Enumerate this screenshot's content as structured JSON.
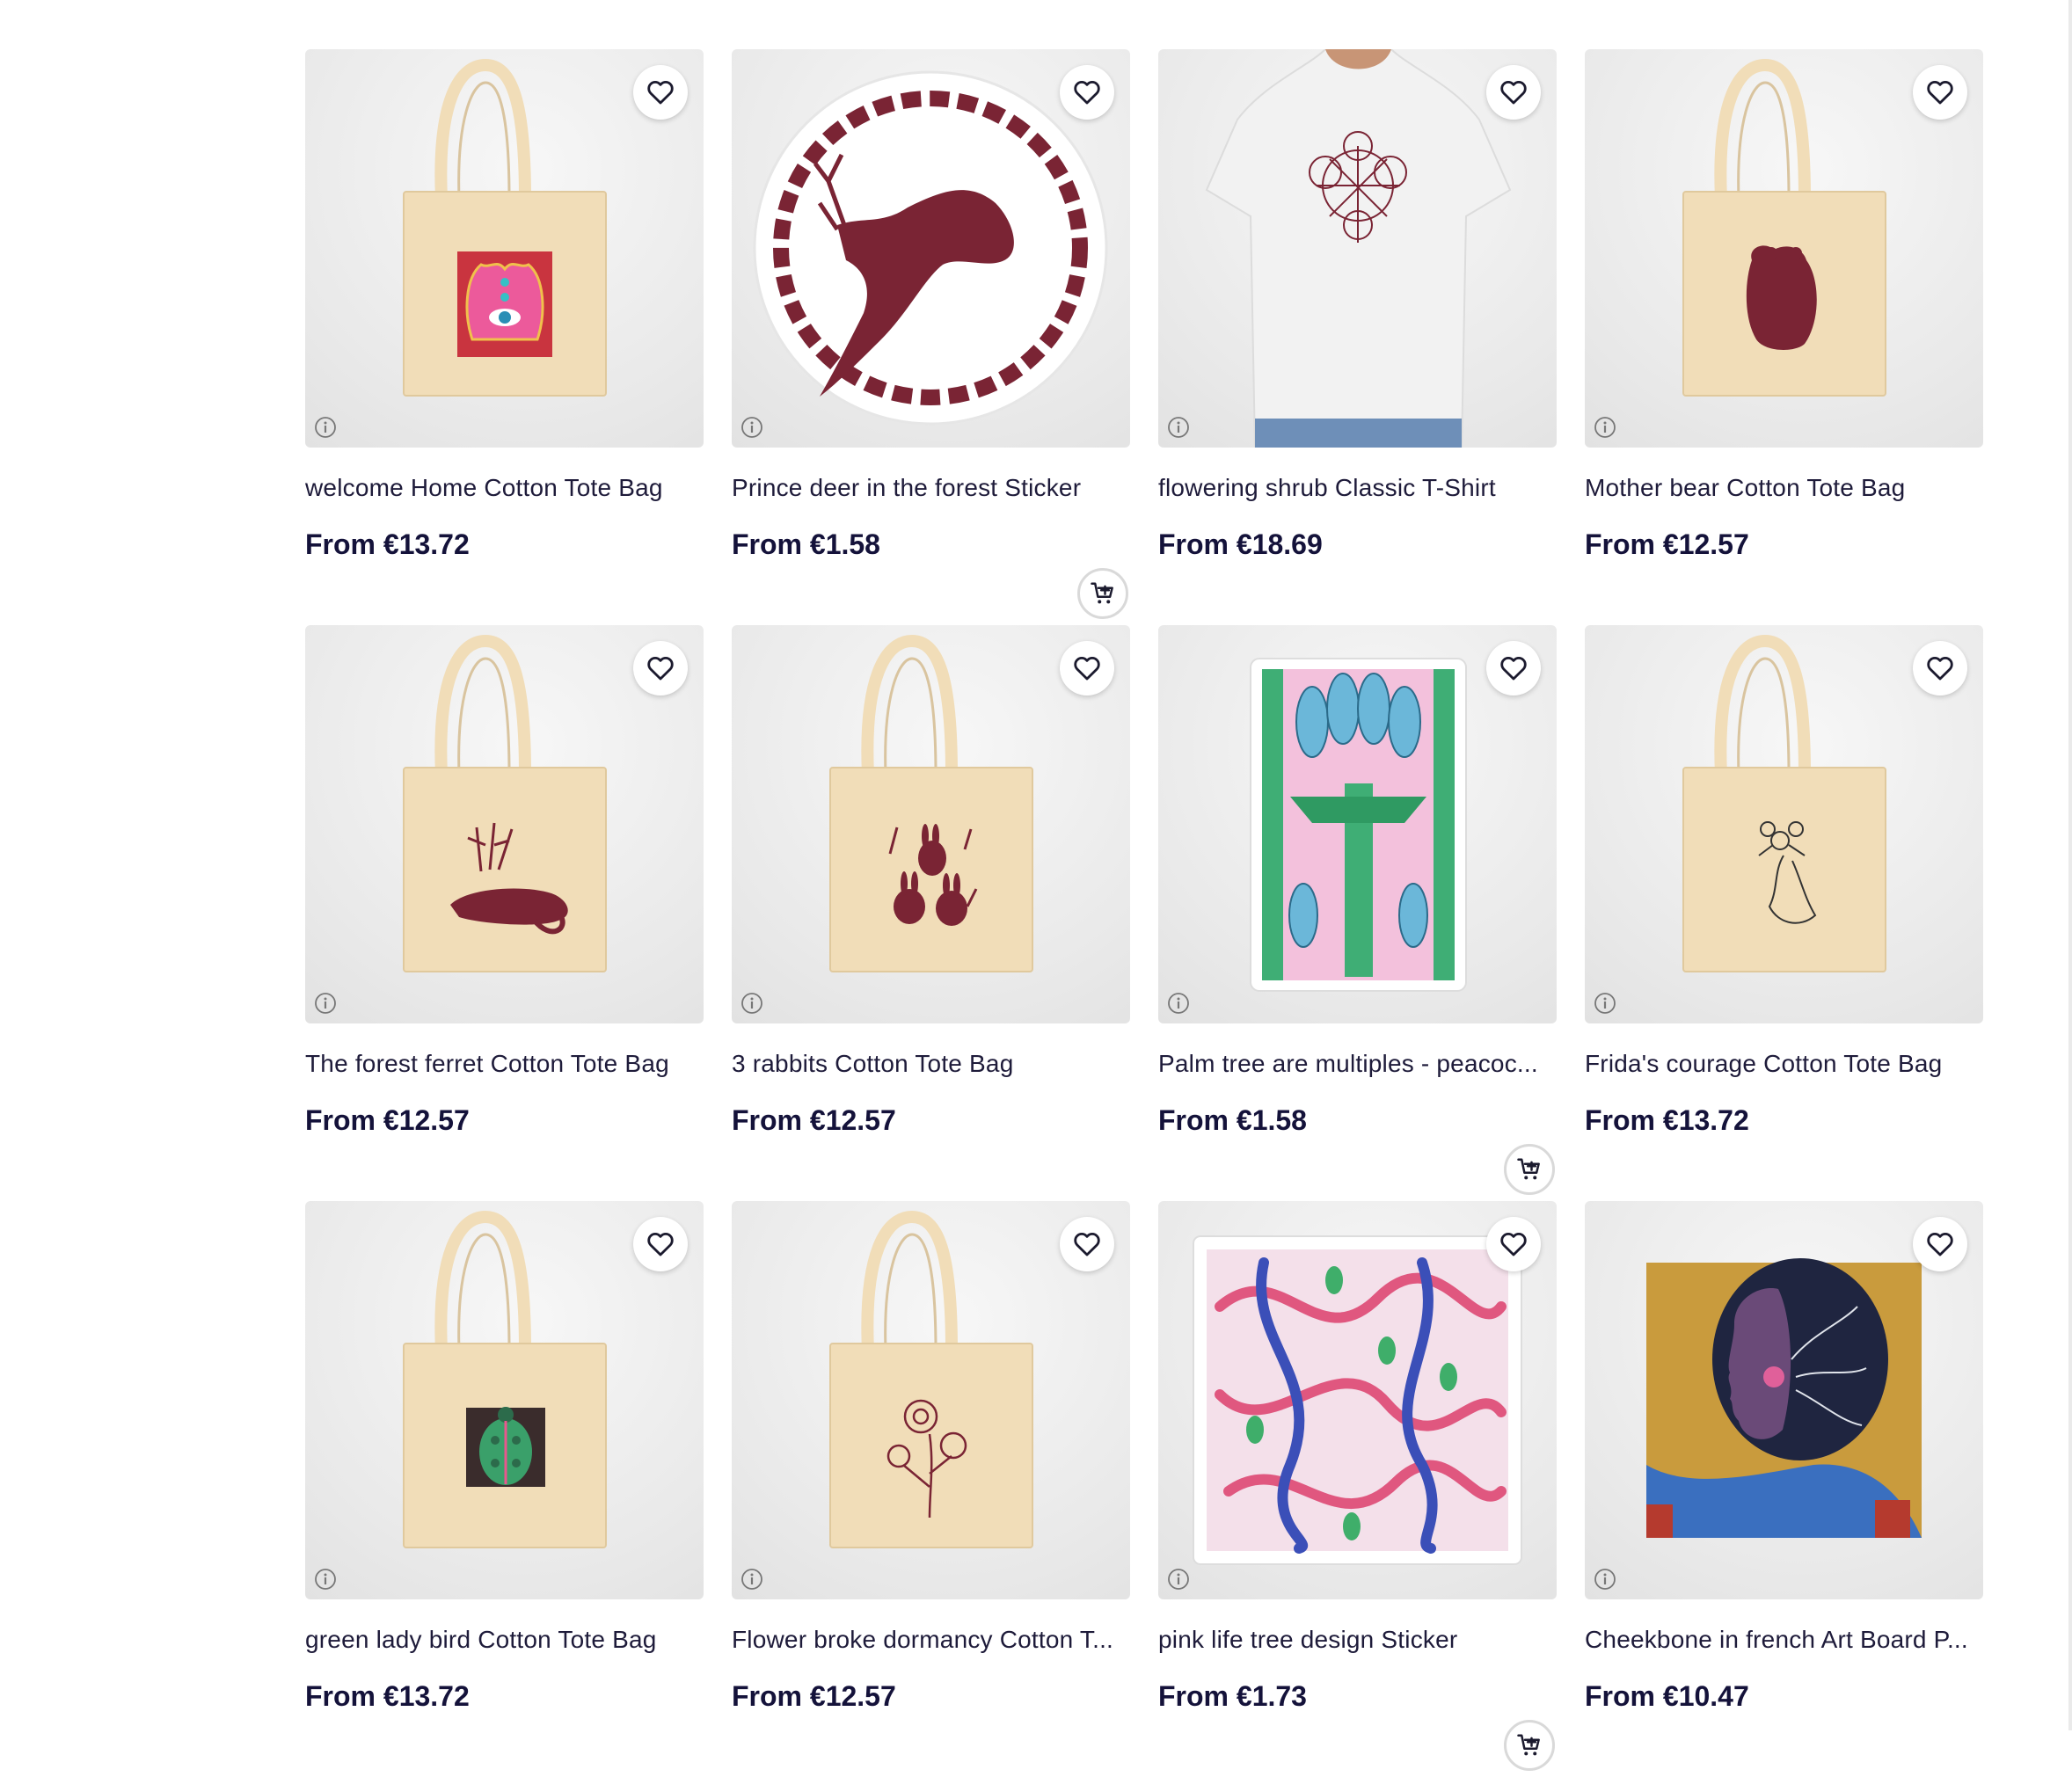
{
  "products": [
    {
      "title": "welcome Home Cotton Tote Bag",
      "price": "From €13.72",
      "type": "tote",
      "motif": "hamsa",
      "cart": false
    },
    {
      "title": "Prince deer in the forest Sticker",
      "price": "From €1.58",
      "type": "sticker-round",
      "motif": "deer",
      "cart": true
    },
    {
      "title": "flowering shrub Classic T-Shirt",
      "price": "From €18.69",
      "type": "tshirt",
      "motif": "shrub",
      "cart": false
    },
    {
      "title": "Mother bear Cotton Tote Bag",
      "price": "From €12.57",
      "type": "tote",
      "motif": "bear",
      "cart": false
    },
    {
      "title": "The forest ferret Cotton Tote Bag",
      "price": "From €12.57",
      "type": "tote",
      "motif": "ferret",
      "cart": false
    },
    {
      "title": "3 rabbits Cotton Tote Bag",
      "price": "From €12.57",
      "type": "tote",
      "motif": "rabbits",
      "cart": false
    },
    {
      "title": "Palm tree are multiples - peacoc...",
      "price": "From €1.58",
      "type": "sticker-rect",
      "motif": "palm",
      "cart": true
    },
    {
      "title": "Frida's courage Cotton Tote Bag",
      "price": "From €13.72",
      "type": "tote",
      "motif": "frida",
      "cart": false
    },
    {
      "title": "green lady bird Cotton Tote Bag",
      "price": "From €13.72",
      "type": "tote",
      "motif": "ladybird",
      "cart": false
    },
    {
      "title": "Flower broke dormancy Cotton T...",
      "price": "From €12.57",
      "type": "tote",
      "motif": "flower",
      "cart": false
    },
    {
      "title": "pink life tree design Sticker",
      "price": "From €1.73",
      "type": "sticker-square",
      "motif": "vines",
      "cart": true
    },
    {
      "title": "Cheekbone in french Art Board P...",
      "price": "From €10.47",
      "type": "artboard",
      "motif": "portrait",
      "cart": false
    }
  ],
  "colors": {
    "text": "#1e1b3a",
    "price": "#14123a",
    "tote": "#f1ddb8",
    "maroon": "#7a2434"
  },
  "icons": {
    "favorite": "heart-icon",
    "info": "info-icon",
    "cart": "add-to-cart-icon"
  }
}
